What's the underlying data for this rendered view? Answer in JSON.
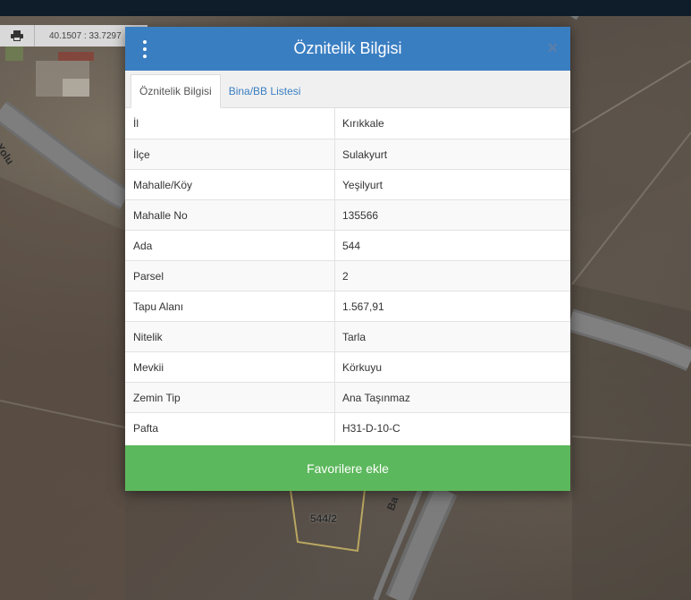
{
  "map": {
    "coordinates": "40.1507 : 33.7297",
    "parcel_label": "544/2",
    "road_label": "Ba",
    "road_label_left": "Yolu"
  },
  "toolbar": {
    "print_icon": "print-icon"
  },
  "modal": {
    "title": "Öznitelik Bilgisi",
    "menu_icon": "kebab-menu-icon",
    "close_icon": "close-icon",
    "close_glyph": "×",
    "tabs": [
      {
        "label": "Öznitelik Bilgisi",
        "active": true
      },
      {
        "label": "Bina/BB Listesi",
        "active": false
      }
    ],
    "rows": [
      {
        "label": "İl",
        "value": "Kırıkkale"
      },
      {
        "label": "İlçe",
        "value": "Sulakyurt"
      },
      {
        "label": "Mahalle/Köy",
        "value": "Yeşilyurt"
      },
      {
        "label": "Mahalle No",
        "value": "135566"
      },
      {
        "label": "Ada",
        "value": "544"
      },
      {
        "label": "Parsel",
        "value": "2"
      },
      {
        "label": "Tapu Alanı",
        "value": "1.567,91"
      },
      {
        "label": "Nitelik",
        "value": "Tarla"
      },
      {
        "label": "Mevkii",
        "value": "Körkuyu"
      },
      {
        "label": "Zemin Tip",
        "value": "Ana Taşınmaz"
      },
      {
        "label": "Pafta",
        "value": "H31-D-10-C"
      }
    ],
    "favorite_button": "Favorilere ekle"
  },
  "colors": {
    "header": "#3a7ec2",
    "favorite_button": "#5cb85c",
    "top_bar": "#0f1c2a"
  }
}
